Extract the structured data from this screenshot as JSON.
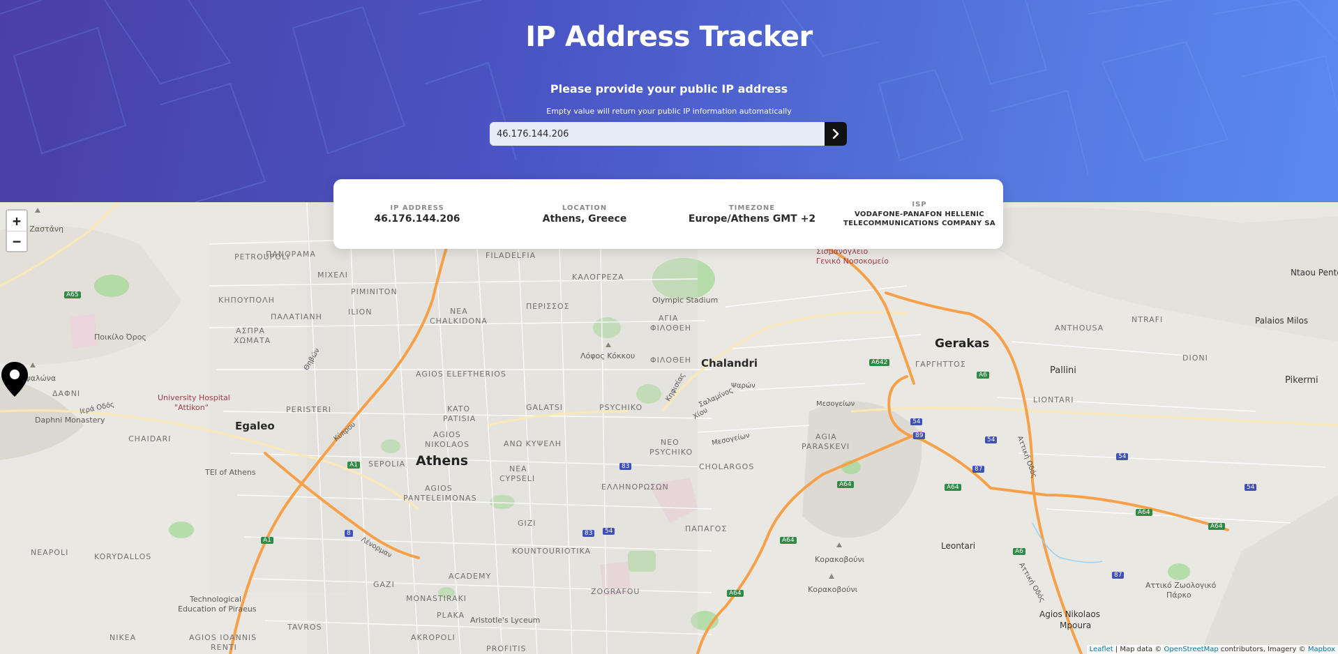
{
  "header": {
    "title": "IP Address Tracker",
    "subtitle": "Please provide your public IP address",
    "hint": "Empty value will return your public IP information automatically"
  },
  "search": {
    "value": "46.176.144.206",
    "submit_icon": "chevron-right-icon"
  },
  "info": {
    "ip_label": "IP ADDRESS",
    "ip_value": "46.176.144.206",
    "location_label": "LOCATION",
    "location_value": "Athens, Greece",
    "timezone_label": "TIMEZONE",
    "timezone_value": "Europe/Athens GMT +2",
    "isp_label": "ISP",
    "isp_value_line1": "VODAFONE-PANAFON HELLENIC",
    "isp_value_line2": "TELECOMMUNICATIONS COMPANY SA"
  },
  "map": {
    "zoom_in": "+",
    "zoom_out": "−",
    "marker_icon": "map-pin-icon",
    "labels": {
      "athens": "Athens",
      "chalandri": "Chalandri",
      "gerakas": "Gerakas",
      "egaleo": "Egaleo",
      "pallini": "Pallini",
      "pikermi": "Pikermi",
      "palaios_milos": "Palaios Milos",
      "leontari": "Leontari",
      "agios_nikolaos": "Agios Nikolaos",
      "mpoura": "Mpoura",
      "ntaou_pente": "Ntaou Pente",
      "olympic_stadium": "Olympic Stadium",
      "university_hospital_1": "University Hospital",
      "university_hospital_2": "\"Attikon\"",
      "daphni": "Daphni Monastery",
      "tei": "TEI of Athens",
      "technological_1": "Technological",
      "technological_2": "Education of Piraeus",
      "aristotle": "Aristotle's Lyceum",
      "poikilo": "Ποικίλο Όρος",
      "lofos": "Λόφος Κόκκου",
      "kapsalona": "Καψαλώνα",
      "korakovouni_1": "Κορακοβούνι",
      "korakovouni_2": "Κορακοβούνι",
      "attiko_zoo_1": "Αττικό Ζωολογικό",
      "attiko_zoo_2": "Πάρκο",
      "filadelfia": "FILADELFIA",
      "petroupoli": "PETROUPOLI",
      "ilion": "ILION",
      "peristeri": "PERISTERI",
      "chaidari": "CHAIDARI",
      "sepolia": "SEPOLIA",
      "agios_eleftherios": "AGIOS ELEFTHERIOS",
      "kato_patisia_1": "KATO",
      "kato_patisia_2": "PATISIA",
      "agios_nikolaos_d_1": "AGIOS",
      "agios_nikolaos_d_2": "NIKOLAOS",
      "galatsi": "GALATSI",
      "psychiko": "PSYCHIKO",
      "neo_psychiko_1": "NEO",
      "neo_psychiko_2": "PSYCHIKO",
      "cholargos": "CHOLARGOS",
      "agia_paraskevi_1": "AGIA",
      "agia_paraskevi_2": "PARASKEVI",
      "nea_cypseli_1": "NEA",
      "nea_cypseli_2": "CYPSELI",
      "agios_panteleimonas_1": "AGIOS",
      "agios_panteleimonas_2": "PANTELEIMONAS",
      "gizi": "GIZI",
      "kountouriotika": "KOUNTOURIOTIKA",
      "zografou": "ZOGRAFOU",
      "academy": "ACADEMY",
      "monastiraki": "MONASTIRAKI",
      "plaka": "PLAKA",
      "akropoli": "AKROPOLI",
      "profitis": "PROFITIS",
      "gazi": "GAZI",
      "tavros": "TAVROS",
      "agios_ioannis_1": "AGIOS IOANNIS",
      "agios_ioannis_2": "RENTI",
      "nikea": "NIKEA",
      "korydallos": "KORYDALLOS",
      "neapoli": "NEAPOLI",
      "nea_chalkidona_1": "NEA",
      "nea_chalkidona_2": "CHALKIDONA",
      "anthousa": "ANTHOUSA",
      "ntrafi": "NTRAFI",
      "dioni": "DIONI",
      "liontari": "LIONTARI",
      "gargittos": "ΓΑΡΓΗΤΤΟΣ",
      "kalogreza": "ΚΑΛΟΓΡΕΖΑ",
      "perissos": "ΠΕΡΙΣΣΟΣ",
      "agia_filothei_1": "ΑΓΙΑ",
      "agia_filothei_2": "ΦΙΛΟΘΕΗ",
      "filothei": "ΦΙΛΟΘΕΗ",
      "ellinoroson": "ΕΛΛΗΝΟΡΩΣΩΝ",
      "papagos": "ΠΑΠΑΓΟΣ",
      "ano_kypseli": "ΑΝΩ ΚΥΨΕΛΗ",
      "mixeli": "ΜΙΧΕΛΙ",
      "kipoupoli": "ΚΗΠΟΥΠΟΛΗ",
      "palatiani": "ΠΑΛΑΤΙΑΝΗ",
      "aspra_chomata_1": "ΑΣΠΡΑ",
      "aspra_chomata_2": "ΧΩΜΑΤΑ",
      "dafni": "ΔΑΦΝΙ",
      "panorama": "ΠΑΝΟΡΑΜΑ",
      "pimiliton": "ΡΙΜΙΝΙΤΟΝ",
      "sismanogleio_1": "Σισμανόγλειο",
      "sismanogleio_2": "Γενικό Νοσοκομείο",
      "zastani": "ο Ζαστάνη"
    },
    "roads": {
      "a1a": "A1",
      "a1b": "A1",
      "a65": "A65",
      "a6a": "A6",
      "a6b": "A6",
      "a642": "A642",
      "a64a": "A64",
      "a64b": "A64",
      "a64c": "A64",
      "a64d": "A64",
      "a64e": "A64",
      "a64f": "A64",
      "r8": "8",
      "r83a": "83",
      "r83b": "83",
      "r54a": "54",
      "r54b": "54",
      "r54c": "54",
      "r54d": "54",
      "r54e": "54",
      "r87a": "87",
      "r87b": "87",
      "r89": "89"
    },
    "streets": {
      "kifisias": "Κηφισίας",
      "mesogeion1": "Μεσογείων",
      "mesogeion2": "Μεσογείων",
      "attiki1": "Αττική Οδός",
      "attiki2": "Αττική Οδός",
      "kefalari": "Σαλαμίνος",
      "xiou": "Χίου",
      "psarwn": "Ψαρών",
      "iera": "Ιερά Οδός",
      "thivon": "Θηβών",
      "kyprou": "Κύπρου",
      "lenorman": "Λένορμαν"
    },
    "attribution": {
      "leaflet": "Leaflet",
      "text1": " | Map data © ",
      "osm": "OpenStreetMap",
      "text2": " contributors, Imagery © ",
      "mapbox": "Mapbox"
    }
  },
  "colors": {
    "header_start": "#4a3fa6",
    "header_end": "#5a8af0",
    "motorway": "#f6a14a",
    "park": "#a8d99a",
    "card_bg": "#ffffff",
    "button_bg": "#111111"
  }
}
